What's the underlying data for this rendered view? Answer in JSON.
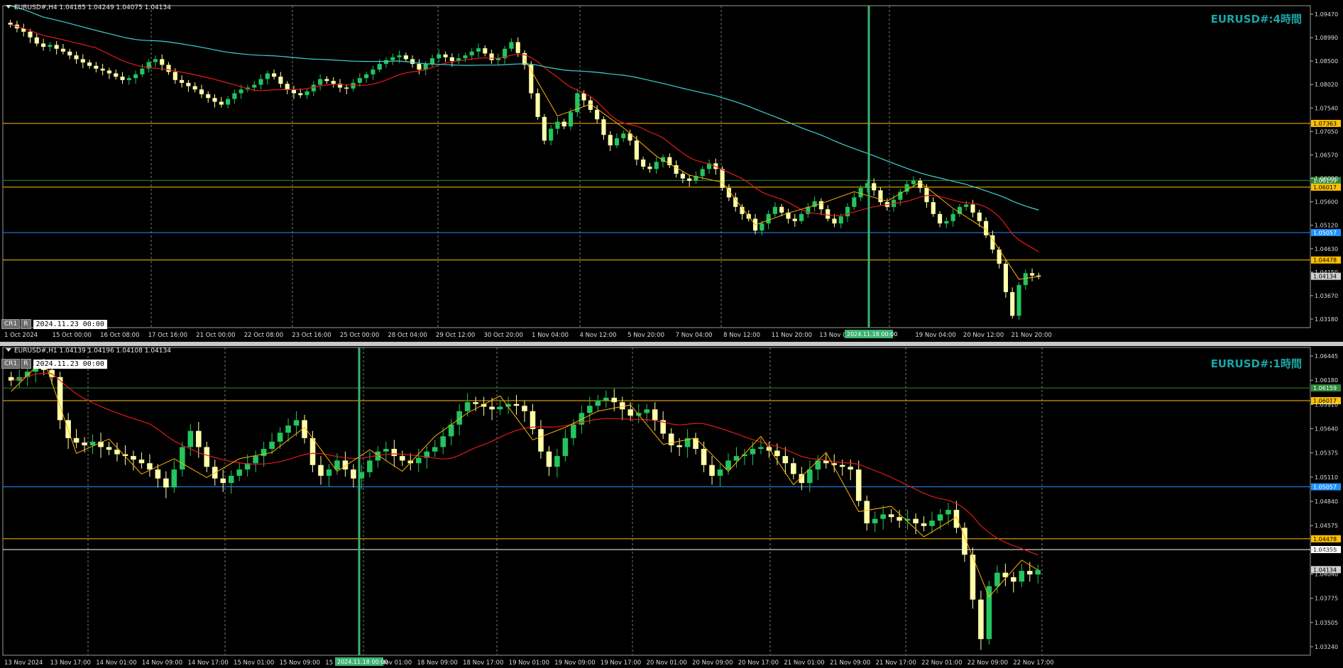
{
  "theme": {
    "bg": "#000000",
    "grid": "#7a7a7a",
    "bull": "#22c55e",
    "bear": "#ffffaa",
    "ma_red": "#e01a1a",
    "ma_cyan": "#3fd3d3",
    "zigzag": "#ffb300",
    "level_orange": "#ffc000",
    "level_blue": "#1e90ff",
    "level_green": "#2e8b3a",
    "vline": "#3cb371",
    "watermark": "#1aa6a6"
  },
  "h4": {
    "header": "EURUSD#,H4  1.04185 1.04249 1.04075 1.04134",
    "watermark": "EURUSD#:4時間",
    "btn_cr1": "CR1",
    "btn_r": "R",
    "datetime": "2024.11.23 00:00",
    "vline_label": "2024.11.18 00:00",
    "price_scale": [
      "1.09470",
      "1.08990",
      "1.08500",
      "1.08020",
      "1.07540",
      "1.07050",
      "1.06570",
      "1.06090",
      "1.05600",
      "1.05120",
      "1.04630",
      "1.04150",
      "1.03670",
      "1.03180"
    ],
    "range": [
      1.0305,
      1.0985
    ],
    "levels": [
      {
        "price": 1.07363,
        "label": "1.07363",
        "color": "orange"
      },
      {
        "price": 1.06159,
        "label": "1.06159",
        "color": "green"
      },
      {
        "price": 1.06017,
        "label": "1.06017",
        "color": "orange"
      },
      {
        "price": 1.05057,
        "label": "1.05057",
        "color": "blue"
      },
      {
        "price": 1.04478,
        "label": "1.04478",
        "color": "orange"
      }
    ],
    "current_price": "1.04134",
    "time_labels": [
      "1 Oct 2024",
      "15 Oct 00:00",
      "16 Oct 08:00",
      "17 Oct 16:00",
      "21 Oct 00:00",
      "22 Oct 08:00",
      "23 Oct 16:00",
      "25 Oct 00:00",
      "28 Oct 04:00",
      "29 Oct 12:00",
      "30 Oct 20:00",
      "1 Nov 04:00",
      "4 Nov 12:00",
      "5 Nov 20:00",
      "7 Nov 04:00",
      "8 Nov 12:00",
      "11 Nov 20:00",
      "13 Nov 04:00",
      "14 Nov",
      "19 Nov 04:00",
      "20 Nov 12:00",
      "21 Nov 20:00"
    ],
    "close": [
      1.0945,
      1.0937,
      1.093,
      1.0918,
      1.0905,
      1.0898,
      1.0902,
      1.0894,
      1.0888,
      1.088,
      1.0872,
      1.0865,
      1.0858,
      1.0852,
      1.0848,
      1.0842,
      1.0835,
      1.0828,
      1.0832,
      1.084,
      1.0852,
      1.0866,
      1.0872,
      1.086,
      1.0845,
      1.0828,
      1.0822,
      1.0815,
      1.0808,
      1.0798,
      1.079,
      1.0782,
      1.0776,
      1.0788,
      1.08,
      1.0808,
      1.0812,
      1.0818,
      1.083,
      1.0842,
      1.0835,
      1.082,
      1.0808,
      1.08,
      1.0796,
      1.0804,
      1.0818,
      1.083,
      1.0826,
      1.082,
      1.0812,
      1.081,
      1.0822,
      1.0832,
      1.084,
      1.085,
      1.0862,
      1.087,
      1.0876,
      1.088,
      1.0872,
      1.0862,
      1.085,
      1.0862,
      1.0874,
      1.0882,
      1.0876,
      1.0868,
      1.0874,
      1.088,
      1.0888,
      1.0895,
      1.0884,
      1.087,
      1.0874,
      1.0894,
      1.0908,
      1.0885,
      1.086,
      1.08,
      1.075,
      1.07,
      1.0725,
      1.074,
      1.073,
      1.076,
      1.08,
      1.0785,
      1.0765,
      1.0745,
      1.0712,
      1.069,
      1.0705,
      1.0715,
      1.07,
      1.066,
      1.0645,
      1.064,
      1.0655,
      1.0665,
      1.0648,
      1.063,
      1.062,
      1.0615,
      1.0625,
      1.064,
      1.0652,
      1.064,
      1.06,
      1.058,
      1.056,
      1.0545,
      1.0535,
      1.051,
      1.0525,
      1.0545,
      1.056,
      1.0548,
      1.0535,
      1.053,
      1.0545,
      1.056,
      1.0572,
      1.0555,
      1.0535,
      1.0525,
      1.054,
      1.056,
      1.058,
      1.06,
      1.061,
      1.0595,
      1.057,
      1.056,
      1.0575,
      1.0592,
      1.0608,
      1.0615,
      1.06,
      1.057,
      1.0545,
      1.0525,
      1.053,
      1.0545,
      1.056,
      1.0565,
      1.0548,
      1.053,
      1.05,
      1.047,
      1.044,
      1.038,
      1.033,
      1.0395,
      1.042,
      1.0415,
      1.0413
    ]
  },
  "h1": {
    "header": "EURUSD#,H1  1.04139 1.04196 1.04108 1.04134",
    "watermark": "EURUSD#:1時間",
    "btn_cr1": "CR1",
    "btn_r": "R",
    "datetime": "2024.11.23 00:00",
    "vline_label": "2024.11.18 00:00",
    "price_scale": [
      "1.06445",
      "1.06180",
      "1.05910",
      "1.05640",
      "1.05375",
      "1.05110",
      "1.04840",
      "1.04575",
      "1.04305",
      "1.04040",
      "1.03775",
      "1.03505",
      "1.03240"
    ],
    "range": [
      1.0318,
      1.0661
    ],
    "levels": [
      {
        "price": 1.06159,
        "label": "1.06159",
        "color": "green"
      },
      {
        "price": 1.06017,
        "label": "1.06017",
        "color": "orange"
      },
      {
        "price": 1.05057,
        "label": "1.05057",
        "color": "blue"
      },
      {
        "price": 1.04478,
        "label": "1.04478",
        "color": "orange"
      },
      {
        "price": 1.04358,
        "label": "1.04358",
        "color": "white"
      }
    ],
    "current_price": "1.04134",
    "time_labels": [
      "13 Nov 2024",
      "13 Nov 17:00",
      "14 Nov 01:00",
      "14 Nov 09:00",
      "14 Nov 17:00",
      "15 Nov 01:00",
      "15 Nov 09:00",
      "15 N",
      "18 Nov 01:00",
      "18 Nov 09:00",
      "18 Nov 17:00",
      "19 Nov 01:00",
      "19 Nov 09:00",
      "19 Nov 17:00",
      "20 Nov 01:00",
      "20 Nov 09:00",
      "20 Nov 17:00",
      "21 Nov 01:00",
      "21 Nov 09:00",
      "21 Nov 17:00",
      "22 Nov 01:00",
      "22 Nov 09:00",
      "22 Nov 17:00"
    ],
    "close": [
      1.0624,
      1.0628,
      1.0634,
      1.064,
      1.0636,
      1.0628,
      1.058,
      1.056,
      1.0555,
      1.0552,
      1.0556,
      1.055,
      1.0547,
      1.0542,
      1.054,
      1.0536,
      1.0532,
      1.0525,
      1.0515,
      1.0505,
      1.0525,
      1.055,
      1.0568,
      1.055,
      1.0528,
      1.0515,
      1.051,
      1.0518,
      1.0525,
      1.0532,
      1.054,
      1.0548,
      1.0556,
      1.0566,
      1.0574,
      1.058,
      1.056,
      1.053,
      1.0518,
      1.0525,
      1.0535,
      1.0525,
      1.0515,
      1.0522,
      1.0535,
      1.0545,
      1.0548,
      1.054,
      1.0535,
      1.0532,
      1.0538,
      1.0545,
      1.055,
      1.0562,
      1.0575,
      1.059,
      1.06,
      1.0598,
      1.0595,
      1.0592,
      1.0595,
      1.0598,
      1.0596,
      1.059,
      1.057,
      1.0545,
      1.0528,
      1.054,
      1.056,
      1.0575,
      1.0588,
      1.0596,
      1.0602,
      1.0605,
      1.06,
      1.0592,
      1.0585,
      1.0588,
      1.0592,
      1.058,
      1.0565,
      1.0552,
      1.055,
      1.056,
      1.0548,
      1.053,
      1.0518,
      1.0525,
      1.0535,
      1.054,
      1.0542,
      1.0548,
      1.055,
      1.0546,
      1.054,
      1.0532,
      1.052,
      1.051,
      1.0525,
      1.0535,
      1.0532,
      1.053,
      1.0528,
      1.0525,
      1.049,
      1.0465,
      1.047,
      1.0475,
      1.0472,
      1.0468,
      1.047,
      1.0465,
      1.0462,
      1.0468,
      1.0475,
      1.048,
      1.046,
      1.043,
      1.038,
      1.0336,
      1.0395,
      1.041,
      1.0405,
      1.04,
      1.0412,
      1.0408,
      1.0413
    ]
  }
}
